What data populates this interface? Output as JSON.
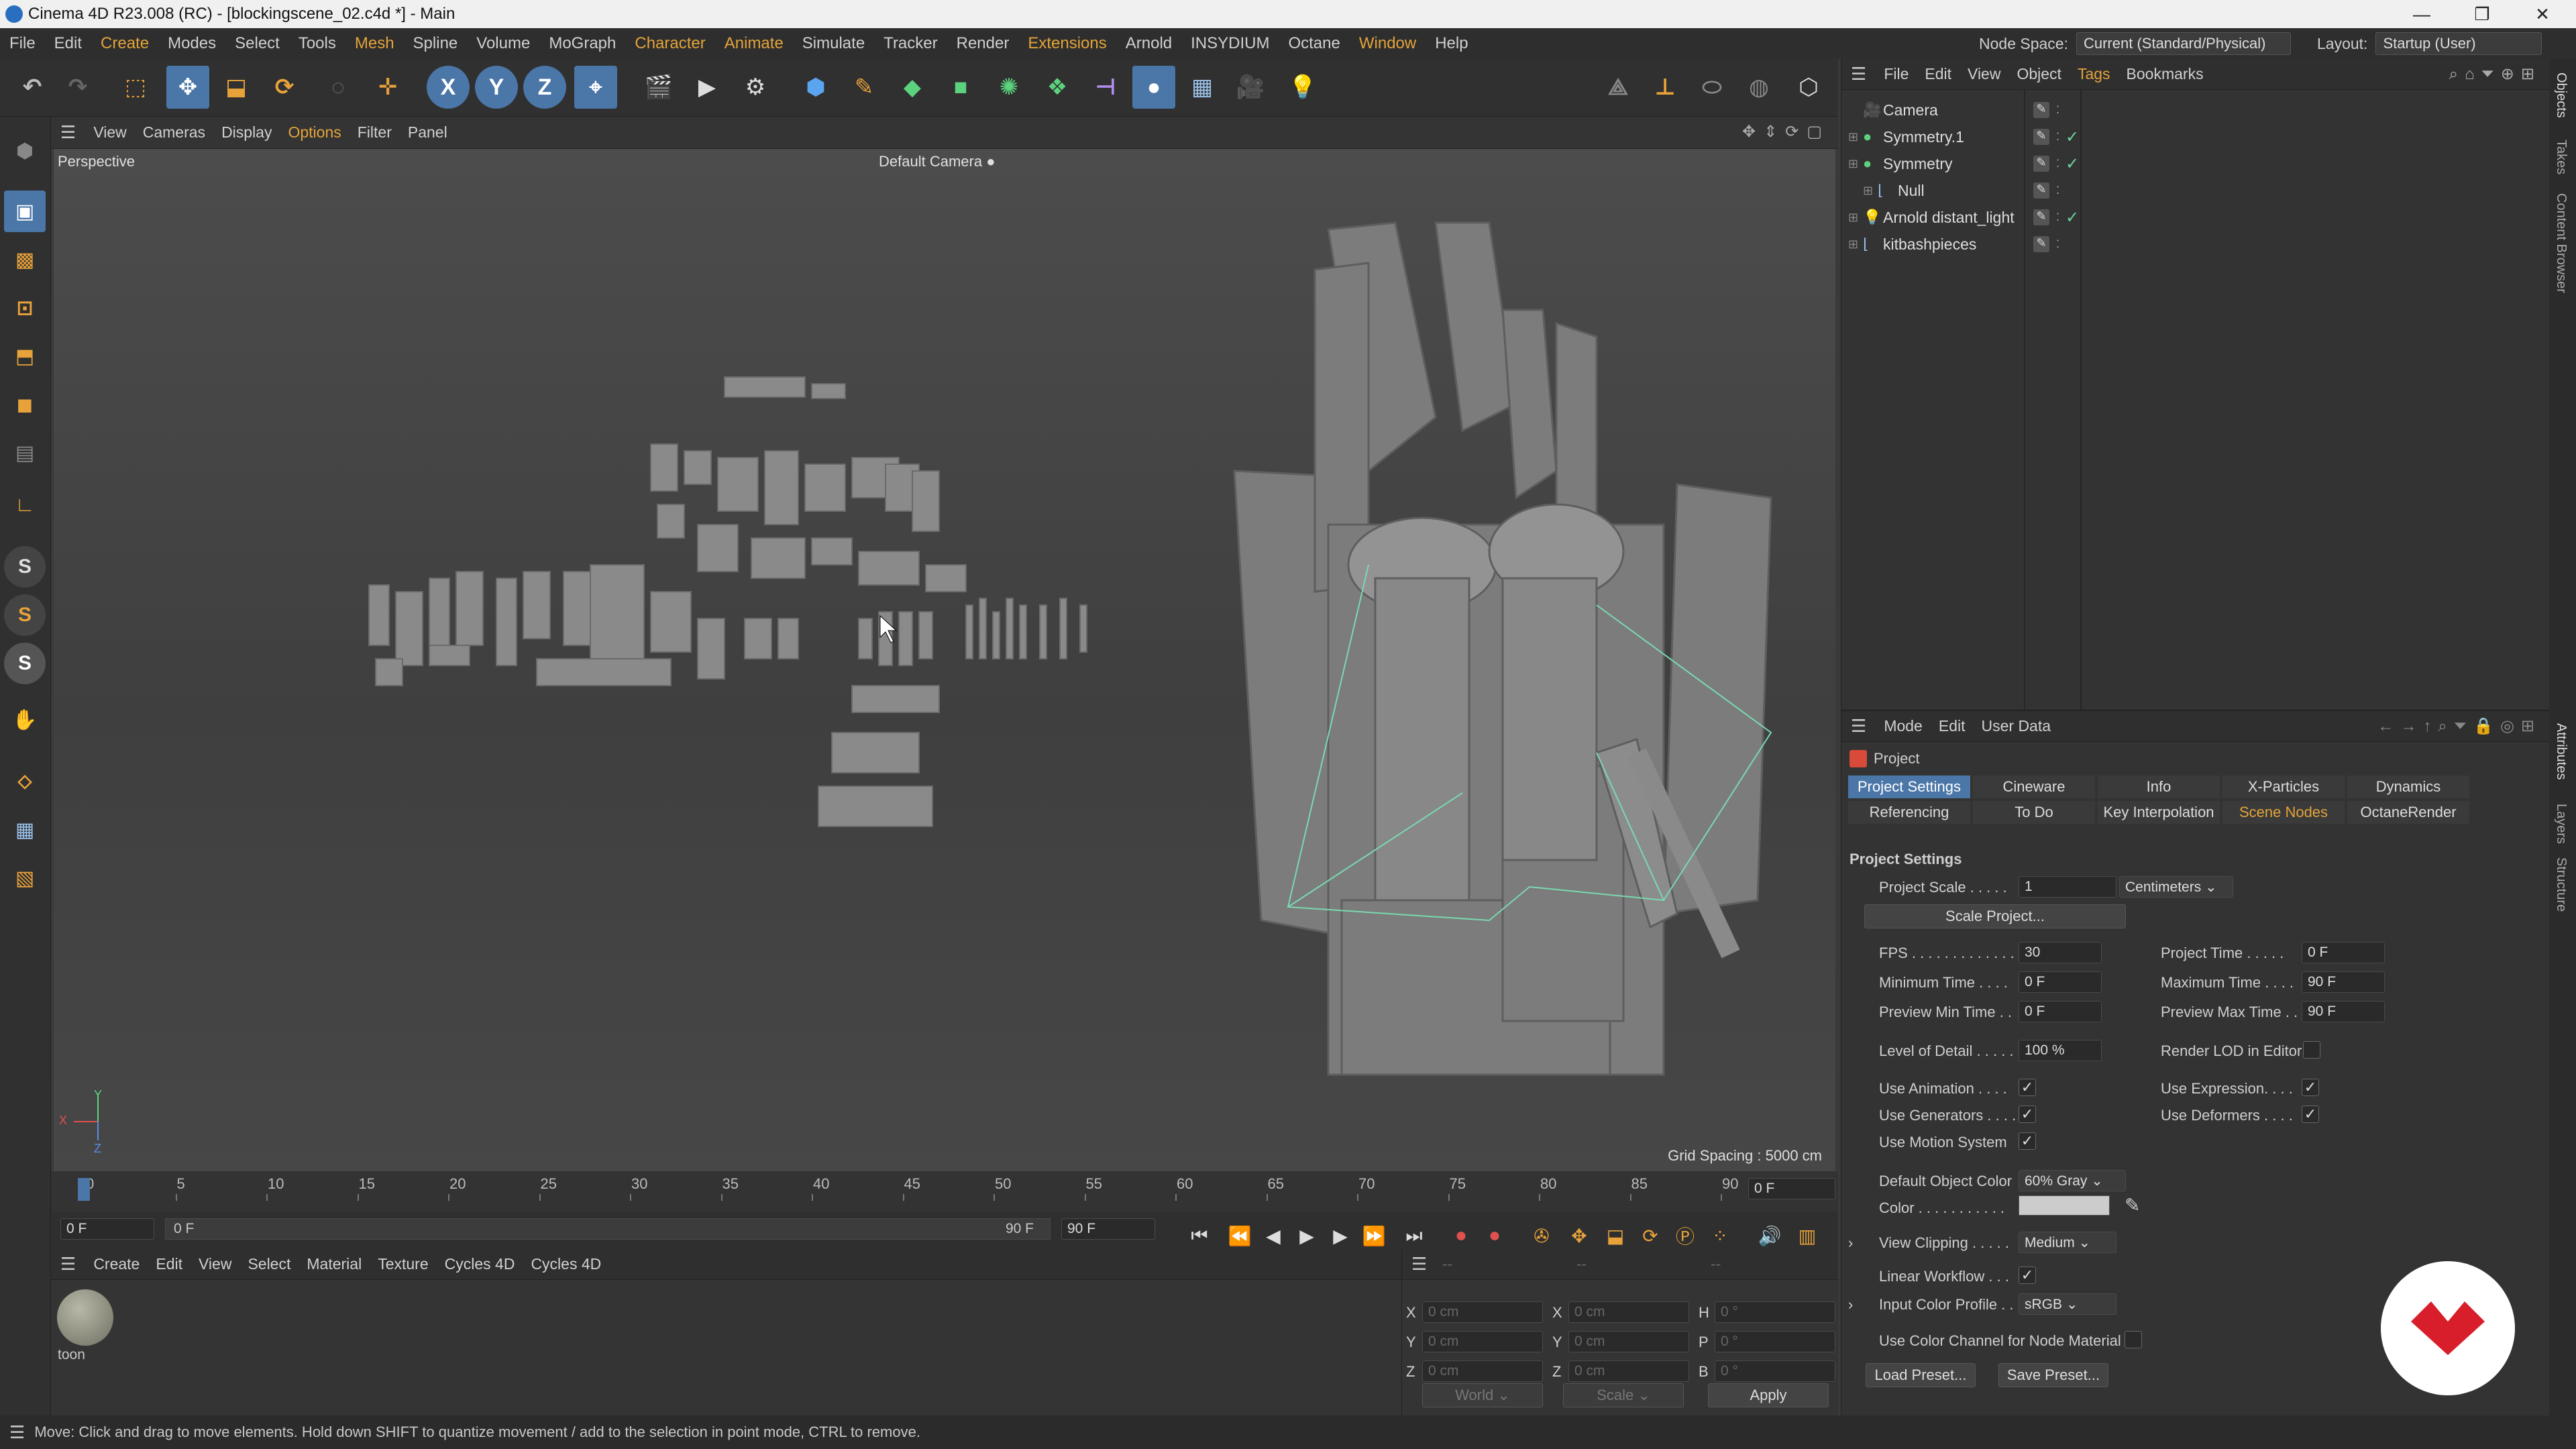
{
  "window": {
    "title": "Cinema 4D R23.008 (RC) - [blockingscene_02.c4d *] - Main"
  },
  "menu": [
    "File",
    "Edit",
    "Create",
    "Modes",
    "Select",
    "Tools",
    "Mesh",
    "Spline",
    "Volume",
    "MoGraph",
    "Character",
    "Animate",
    "Simulate",
    "Tracker",
    "Render",
    "Extensions",
    "Arnold",
    "INSYDIUM",
    "Octane",
    "Window",
    "Help"
  ],
  "menu_highlight": [
    "Create",
    "Mesh",
    "Character",
    "Animate",
    "Extensions",
    "Window"
  ],
  "node_space": {
    "label": "Node Space:",
    "value": "Current (Standard/Physical)"
  },
  "layout": {
    "label": "Layout:",
    "value": "Startup (User)"
  },
  "toolbar_icons": [
    "undo-icon",
    "redo-icon",
    "live-selection-icon",
    "move-icon",
    "scale-icon",
    "rotate-icon",
    "recent-tool-icon",
    "axis-icon",
    "x-axis-icon",
    "y-axis-icon",
    "z-axis-icon",
    "coordinate-system-icon",
    "render-view-icon",
    "render-picture-viewer-icon",
    "render-settings-icon",
    "cube-icon",
    "pen-icon",
    "subdivision-icon",
    "extrude-icon",
    "cloner-icon",
    "mograph-icon",
    "bend-icon",
    "sculpt-icon",
    "floor-icon",
    "camera-icon",
    "light-icon"
  ],
  "axis_letters": {
    "x": "X",
    "y": "Y",
    "z": "Z"
  },
  "viewport": {
    "menu": [
      "View",
      "Cameras",
      "Display",
      "Options",
      "Filter",
      "Panel"
    ],
    "menu_highlight": "Options",
    "name": "Perspective",
    "camera": "Default Camera",
    "grid_spacing": "Grid Spacing : 5000 cm",
    "axis": {
      "x": "X",
      "y": "Y",
      "z": "Z"
    }
  },
  "timeline": {
    "ticks": [
      0,
      5,
      10,
      15,
      20,
      25,
      30,
      35,
      40,
      45,
      50,
      55,
      60,
      65,
      70,
      75,
      80,
      85,
      90
    ],
    "current_frame": "0 F",
    "start": "0 F",
    "range_start": "0 F",
    "range_end": "90 F",
    "end": "90 F"
  },
  "material_manager": {
    "menu": [
      "Create",
      "Edit",
      "View",
      "Select",
      "Material",
      "Texture",
      "Cycles 4D",
      "Cycles 4D"
    ],
    "materials": [
      {
        "name": "toon"
      }
    ]
  },
  "coordinates": {
    "header": [
      "--",
      "--",
      "--"
    ],
    "rows": [
      {
        "a": "X",
        "av": "0 cm",
        "b": "X",
        "bv": "0 cm",
        "c": "H",
        "cv": "0 °"
      },
      {
        "a": "Y",
        "av": "0 cm",
        "b": "Y",
        "bv": "0 cm",
        "c": "P",
        "cv": "0 °"
      },
      {
        "a": "Z",
        "av": "0 cm",
        "b": "Z",
        "bv": "0 cm",
        "c": "B",
        "cv": "0 °"
      }
    ],
    "mode": "World",
    "scale": "Scale",
    "apply": "Apply"
  },
  "status": "Move: Click and drag to move elements. Hold down SHIFT to quantize movement / add to the selection in point mode, CTRL to remove.",
  "object_manager": {
    "menu": [
      "File",
      "Edit",
      "View",
      "Object",
      "Tags",
      "Bookmarks"
    ],
    "menu_highlight": "Tags",
    "objects": [
      {
        "name": "Camera",
        "icon": "camera-icon",
        "indent": 0,
        "check": ""
      },
      {
        "name": "Symmetry.1",
        "icon": "symmetry-icon",
        "indent": 0,
        "check": "✓"
      },
      {
        "name": "Symmetry",
        "icon": "symmetry-icon",
        "indent": 0,
        "check": "✓"
      },
      {
        "name": "Null",
        "icon": "null-icon",
        "indent": 1,
        "check": ""
      },
      {
        "name": "Arnold distant_light",
        "icon": "light-icon",
        "indent": 0,
        "check": "✓"
      },
      {
        "name": "kitbashpieces",
        "icon": "null-icon",
        "indent": 0,
        "check": ""
      }
    ]
  },
  "attributes": {
    "menu": [
      "Mode",
      "Edit",
      "User Data"
    ],
    "title": "Project",
    "tabs_row1": [
      "Project Settings",
      "Cineware",
      "Info",
      "X-Particles",
      "Dynamics"
    ],
    "tabs_row2": [
      "Referencing",
      "To Do",
      "Key Interpolation",
      "Scene Nodes",
      "OctaneRender"
    ],
    "active_tab": "Project Settings",
    "highlight_tabs": [
      "Scene Nodes"
    ],
    "section": "Project Settings",
    "project_scale": {
      "label": "Project Scale . . . . .",
      "value": "1",
      "unit": "Centimeters"
    },
    "scale_project": "Scale Project...",
    "fps": {
      "label": "FPS . . . . . . . . . . . . .",
      "value": "30"
    },
    "project_time": {
      "label": "Project Time . . . . .",
      "value": "0 F"
    },
    "min_time": {
      "label": "Minimum Time . . . .",
      "value": "0 F"
    },
    "max_time": {
      "label": "Maximum Time . . . .",
      "value": "90 F"
    },
    "prev_min": {
      "label": "Preview Min Time . .",
      "value": "0 F"
    },
    "prev_max": {
      "label": "Preview Max Time . .",
      "value": "90 F"
    },
    "lod": {
      "label": "Level of Detail . . . . .",
      "value": "100 %"
    },
    "render_lod": {
      "label": "Render LOD in Editor",
      "checked": false
    },
    "use_animation": {
      "label": "Use Animation . . . .",
      "checked": true
    },
    "use_expression": {
      "label": "Use Expression. . . .",
      "checked": true
    },
    "use_generators": {
      "label": "Use Generators . . . .",
      "checked": true
    },
    "use_deformers": {
      "label": "Use Deformers . . . .",
      "checked": true
    },
    "use_motion": {
      "label": "Use Motion System",
      "checked": true
    },
    "default_color": {
      "label": "Default Object Color",
      "value": "60% Gray"
    },
    "color": {
      "label": "Color . . . . . . . . . . .",
      "hex": "#cccccc"
    },
    "view_clipping": {
      "label": "View Clipping . . . . .",
      "value": "Medium"
    },
    "linear_workflow": {
      "label": "Linear Workflow . . .",
      "checked": true
    },
    "input_profile": {
      "label": "Input Color Profile . .",
      "value": "sRGB"
    },
    "node_color": {
      "label": "Use Color Channel for Node Material",
      "checked": false
    },
    "load_preset": "Load Preset...",
    "save_preset": "Save Preset..."
  },
  "side_tabs": [
    "Objects",
    "Takes",
    "Content Browser",
    "Attributes",
    "Layers",
    "Structure"
  ],
  "colors": {
    "accent": "#4a76a8",
    "highlight": "#e4a43a",
    "check": "#6fd39a",
    "logo": "#d81e2a"
  }
}
